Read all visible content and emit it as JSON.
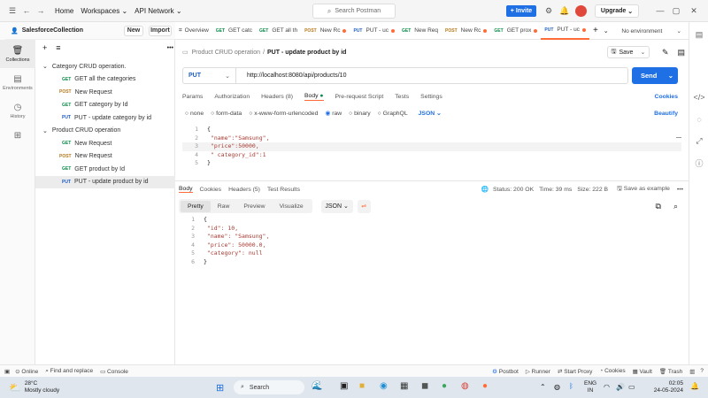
{
  "topbar": {
    "home": "Home",
    "workspaces": "Workspaces",
    "api_network": "API Network",
    "search_placeholder": "Search Postman",
    "invite": "Invite",
    "upgrade": "Upgrade"
  },
  "rail": {
    "items": [
      "Collections",
      "Environments",
      "History"
    ]
  },
  "sidebar": {
    "workspace": "SalesforceCollection",
    "new": "New",
    "import": "Import",
    "folders": [
      {
        "name": "Category CRUD operation.",
        "requests": [
          {
            "method": "GET",
            "name": "GET all the categories"
          },
          {
            "method": "POST",
            "name": "New Request"
          },
          {
            "method": "GET",
            "name": "GET category by Id"
          },
          {
            "method": "PUT",
            "name": "PUT - update category by id"
          }
        ]
      },
      {
        "name": "Product CRUD operation",
        "requests": [
          {
            "method": "GET",
            "name": "New Request"
          },
          {
            "method": "POST",
            "name": "New Request"
          },
          {
            "method": "GET",
            "name": "GET product by Id"
          },
          {
            "method": "PUT",
            "name": "PUT - update product by id"
          }
        ]
      }
    ]
  },
  "tabs": [
    {
      "method": "",
      "label": "Overview"
    },
    {
      "method": "GET",
      "label": "GET catc"
    },
    {
      "method": "GET",
      "label": "GET all th"
    },
    {
      "method": "POST",
      "label": "New Rc"
    },
    {
      "method": "PUT",
      "label": "PUT - uc"
    },
    {
      "method": "GET",
      "label": "New Req"
    },
    {
      "method": "POST",
      "label": "New Rc"
    },
    {
      "method": "GET",
      "label": "GET prox"
    },
    {
      "method": "PUT",
      "label": "PUT - uc"
    }
  ],
  "environment": "No environment",
  "breadcrumb": {
    "parent": "Product CRUD operation",
    "current": "PUT - update product by id"
  },
  "save": "Save",
  "request": {
    "method": "PUT",
    "url": "http://localhost:8080/api/products/10",
    "send": "Send"
  },
  "req_tabs": [
    "Params",
    "Authorization",
    "Headers (8)",
    "Body",
    "Pre-request Script",
    "Tests",
    "Settings"
  ],
  "cookies": "Cookies",
  "body_types": [
    "none",
    "form-data",
    "x-www-form-urlencoded",
    "raw",
    "binary",
    "GraphQL"
  ],
  "body_format": "JSON",
  "beautify": "Beautify",
  "request_body": [
    "{",
    "  \"name\":\"Samsung\",",
    "  \"price\":50000,",
    "  \" category_id\":1",
    "}"
  ],
  "response": {
    "tabs": [
      "Body",
      "Cookies",
      "Headers (5)",
      "Test Results"
    ],
    "status": "Status: 200 OK",
    "time": "Time: 39 ms",
    "size": "Size: 222 B",
    "save_example": "Save as example",
    "views": [
      "Pretty",
      "Raw",
      "Preview",
      "Visualize"
    ],
    "format": "JSON",
    "body": [
      "{",
      "    \"id\": 10,",
      "    \"name\": \"Samsung\",",
      "    \"price\": 50000.0,",
      "    \"category\": null",
      "}"
    ]
  },
  "statusbar": {
    "left": [
      "Online",
      "Find and replace",
      "Console"
    ],
    "right": [
      "Postbot",
      "Runner",
      "Start Proxy",
      "Cookies",
      "Vault",
      "Trash"
    ]
  },
  "taskbar": {
    "temp": "28°C",
    "weather": "Mostly cloudy",
    "search": "Search",
    "lang1": "ENG",
    "lang2": "IN",
    "time": "02:05",
    "date": "24-05-2024"
  }
}
